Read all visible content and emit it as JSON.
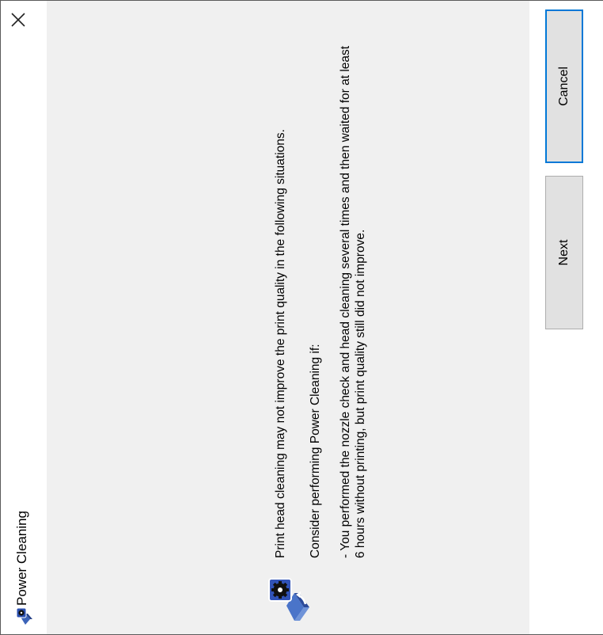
{
  "window": {
    "title": "Power Cleaning"
  },
  "content": {
    "intro": "Print head cleaning may not improve the print quality in the following situations.",
    "consider": "Consider performing Power Cleaning if:",
    "bullet": "- You performed the nozzle check and head cleaning several times and then waited for at least 6 hours without printing, but print quality still did not improve."
  },
  "buttons": {
    "next_label": "Next",
    "cancel_label": "Cancel"
  },
  "icons": {
    "title": "printer-settings-icon",
    "main": "printer-gear-icon",
    "close": "close-icon"
  },
  "colors": {
    "content_background": "#f0f0f0",
    "focus_border": "#0078d7",
    "button_face": "#e1e1e1"
  }
}
